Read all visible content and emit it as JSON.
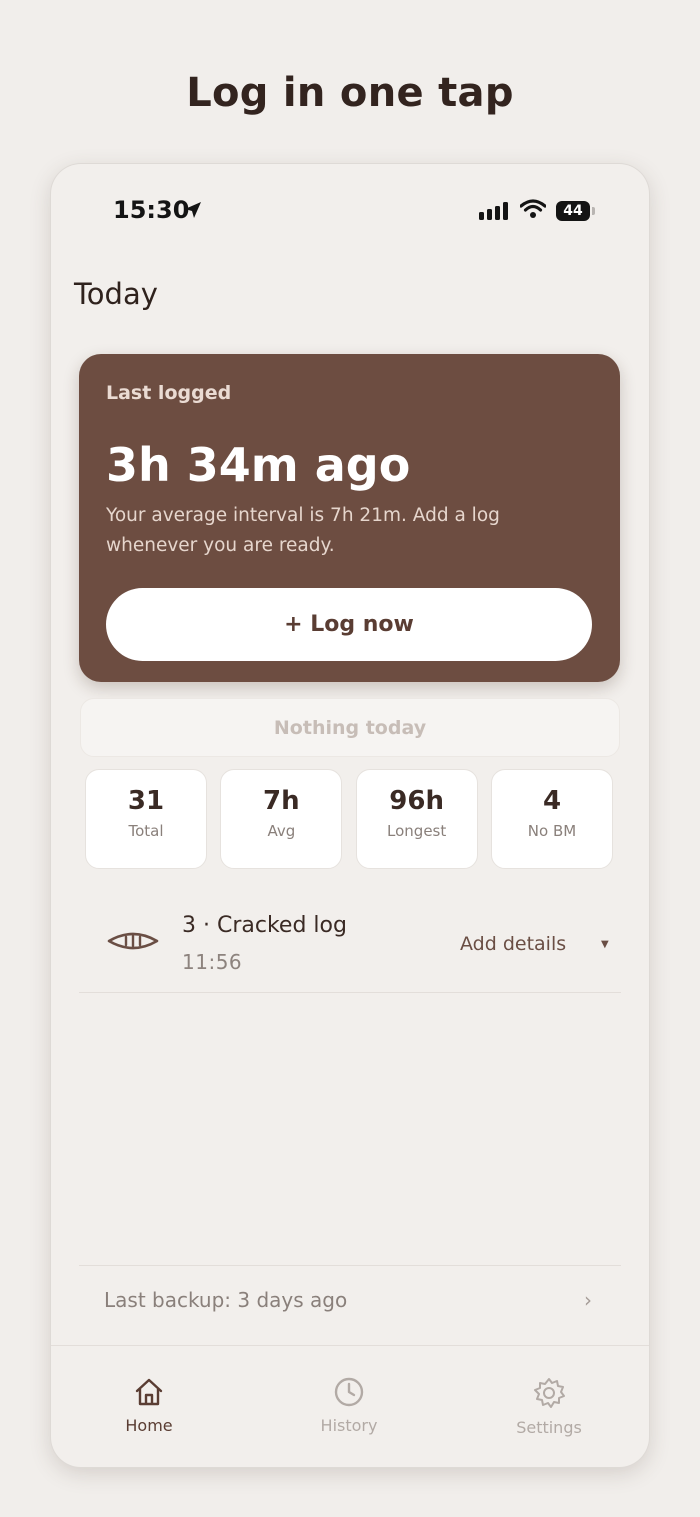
{
  "headline": "Log in one tap",
  "status_bar": {
    "time": "15:30",
    "battery": "44"
  },
  "page": {
    "title": "Today"
  },
  "hero": {
    "label": "Last logged",
    "value": "3h 34m ago",
    "description": "Your average interval is 7h 21m. Add a log whenever you are ready.",
    "button_label": "+ Log now",
    "background_color": "#6d4d41"
  },
  "nothing_today": "Nothing today",
  "stats": [
    {
      "value": "31",
      "label": "Total"
    },
    {
      "value": "7h",
      "label": "Avg"
    },
    {
      "value": "96h",
      "label": "Longest"
    },
    {
      "value": "4",
      "label": "No BM"
    }
  ],
  "entries": [
    {
      "icon": "cracked-log-icon",
      "title": "3 · Cracked log",
      "time": "11:56",
      "action": "Add details"
    }
  ],
  "backup": {
    "text": "Last backup: 3 days ago"
  },
  "tabs": [
    {
      "label": "Home",
      "icon": "home-icon",
      "active": true
    },
    {
      "label": "History",
      "icon": "clock-icon",
      "active": false
    },
    {
      "label": "Settings",
      "icon": "gear-icon",
      "active": false
    }
  ],
  "colors": {
    "accent": "#6d4d41",
    "background": "#f2efec",
    "inactive": "#b2aaa5"
  }
}
